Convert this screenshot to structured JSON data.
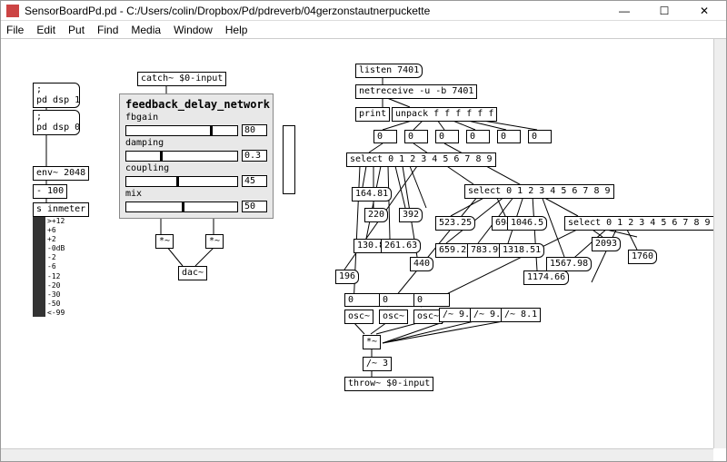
{
  "window": {
    "title": "SensorBoardPd.pd  - C:/Users/colin/Dropbox/Pd/pdreverb/04gerzonstautnerpuckette",
    "min": "—",
    "max": "☐",
    "close": "✕"
  },
  "menu": {
    "file": "File",
    "edit": "Edit",
    "put": "Put",
    "find": "Find",
    "media": "Media",
    "window": "Window",
    "help": "Help"
  },
  "left": {
    "dsp1": ";\npd dsp 1",
    "dsp0": ";\npd dsp 0",
    "env": "env~ 2048",
    "hundred": "- 100",
    "inmeter": "s inmeter"
  },
  "vu_scale": [
    ">+12",
    "+6",
    "+2",
    "-0dB",
    "-2",
    "-6",
    "-12",
    "-20",
    "-30",
    "-50",
    "<-99"
  ],
  "fdn": {
    "title": "feedback_delay_network",
    "fbgain_label": "fbgain",
    "fbgain_val": "80",
    "damping_label": "damping",
    "damping_val": "0.3",
    "coupling_label": "coupling",
    "coupling_val": "45",
    "mix_label": "mix",
    "mix_val": "50",
    "catch": "catch~ $0-input",
    "mul1": "*~",
    "mul2": "*~",
    "dac": "dac~"
  },
  "net": {
    "listen": "listen 7401",
    "netreceive": "netreceive -u -b 7401",
    "print": "print",
    "unpack": "unpack f f f f f f",
    "z0a": "0",
    "z0b": "0",
    "z0c": "0",
    "z0d": "0",
    "z0e": "0",
    "z0f": "0",
    "sel1": "select 0 1 2 3 4 5 6 7 8 9",
    "sel2": "select 0 1 2 3 4 5 6 7 8 9",
    "sel3": "select 0 1 2 3 4 5 6 7 8 9",
    "n164": "164.81",
    "n220": "220",
    "n392": "392",
    "n523": "523.25",
    "n698": "698.46",
    "n1046": "1046.5",
    "n130": "130.81",
    "n261": "261.63",
    "n440": "440",
    "n659": "659.25",
    "n783": "783.99",
    "n1318": "1318.51",
    "n2093": "2093",
    "n1760": "1760",
    "n1174": "1174.66",
    "n1567": "1567.98",
    "n196": "196",
    "nz1": "0",
    "nz2": "0",
    "nz3": "0",
    "osc1": "osc~",
    "osc2": "osc~",
    "osc3": "osc~",
    "d91a": "/~ 9.1",
    "d91b": "/~ 9.1",
    "d81": "/~ 8.1",
    "mul3": "*~",
    "d3": "/~ 3",
    "throw": "throw~ $0-input"
  }
}
